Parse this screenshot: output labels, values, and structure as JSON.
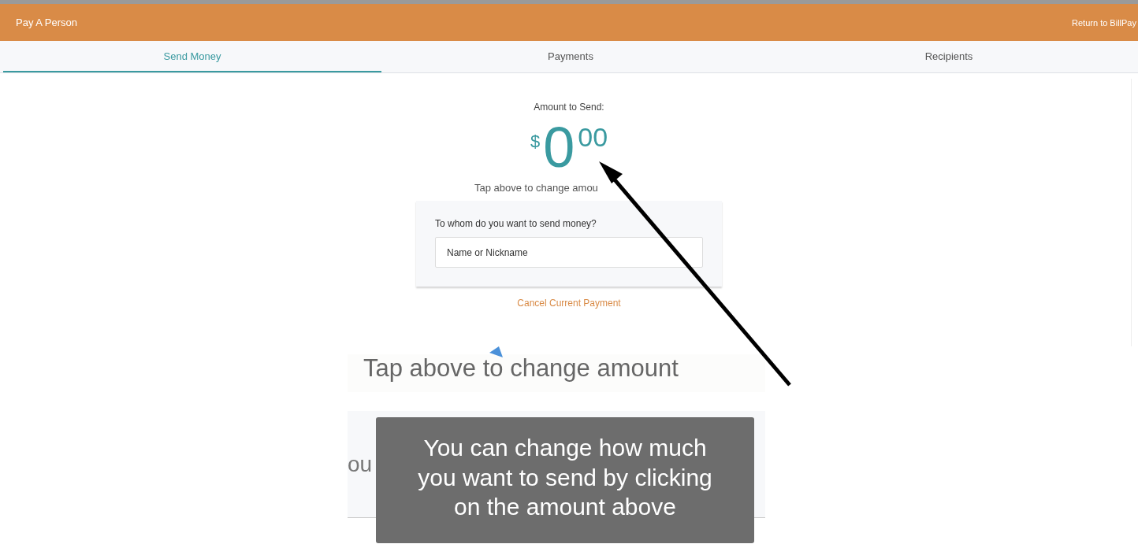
{
  "header": {
    "title": "Pay A Person",
    "link": "Return to BillPay"
  },
  "tabs": [
    {
      "label": "Send Money",
      "selected": true
    },
    {
      "label": "Payments",
      "selected": false
    },
    {
      "label": "Recipients",
      "selected": false
    }
  ],
  "amount": {
    "label": "Amount to Send:",
    "currency": "$",
    "whole": "0",
    "cents": "00",
    "hint": "Tap above to change amou"
  },
  "recipient_card": {
    "question": "To whom do you want to send money?",
    "placeholder": "Name or Nickname"
  },
  "cancel_link": "Cancel Current Payment",
  "zoom_inset": {
    "hint": "Tap above to change amount",
    "hidden_label": "ou",
    "tooltip": "You can change how much you want to send by clicking on the amount above"
  }
}
